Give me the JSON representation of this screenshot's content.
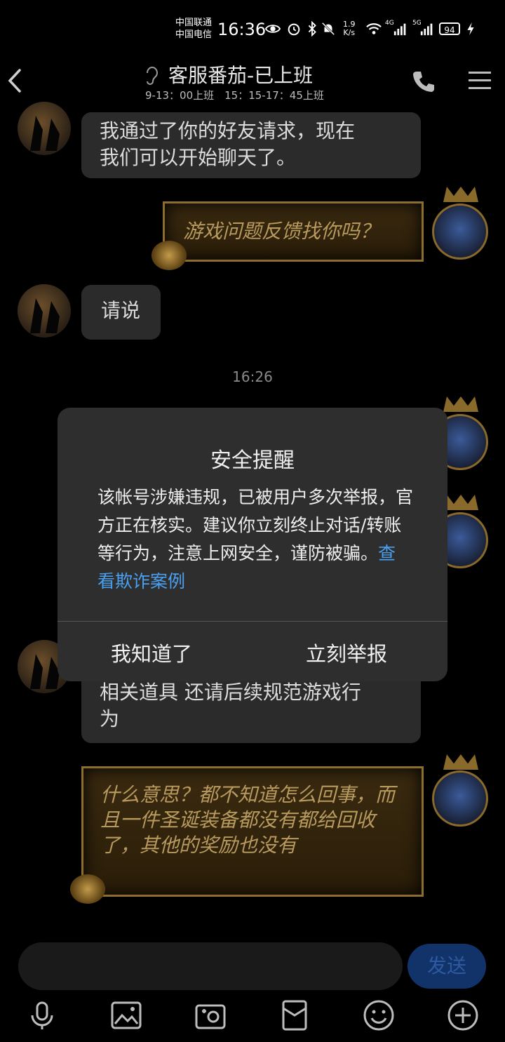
{
  "status_bar": {
    "carrier1": "中国联通",
    "carrier2": "中国电信",
    "time": "16:36",
    "speed_value": "1.9",
    "speed_unit": "K/s",
    "signal1": "4G",
    "signal2": "5G",
    "battery": "94"
  },
  "header": {
    "title": "客服番茄-已上班",
    "subtitle": "9-13：00上班　15：15-17：45上班"
  },
  "messages": [
    {
      "side": "left",
      "text_line1": "我通过了你的好友请求，现在",
      "text_line2": "我们可以开始聊天了。"
    },
    {
      "side": "right",
      "text": "游戏问题反馈找你吗？"
    },
    {
      "side": "left",
      "text": "请说"
    },
    {
      "side": "left",
      "text_line1": "相关道具  还请后续规范游戏行",
      "text_line2": "为"
    },
    {
      "side": "right",
      "text": "什么意思？都不知道怎么回事，而且一件圣诞装备都没有都给回收了，其他的奖励也没有"
    }
  ],
  "timestamp": "16:26",
  "dialog": {
    "title": "安全提醒",
    "body": "该帐号涉嫌违规，已被用户多次举报，官方正在核实。建议你立刻终止对话/转账等行为，注意上网安全，谨防被骗。",
    "link": "查看欺诈案例",
    "btn_ok": "我知道了",
    "btn_report": "立刻举报"
  },
  "input": {
    "send": "发送"
  },
  "toolbar": [
    "voice-icon",
    "image-icon",
    "camera-icon",
    "red-packet-icon",
    "emoji-icon",
    "plus-icon"
  ],
  "colors": {
    "background": "#000000",
    "link": "#4aa0f0",
    "send_button": "#12336a",
    "gold_border": "#8b6d2d"
  }
}
